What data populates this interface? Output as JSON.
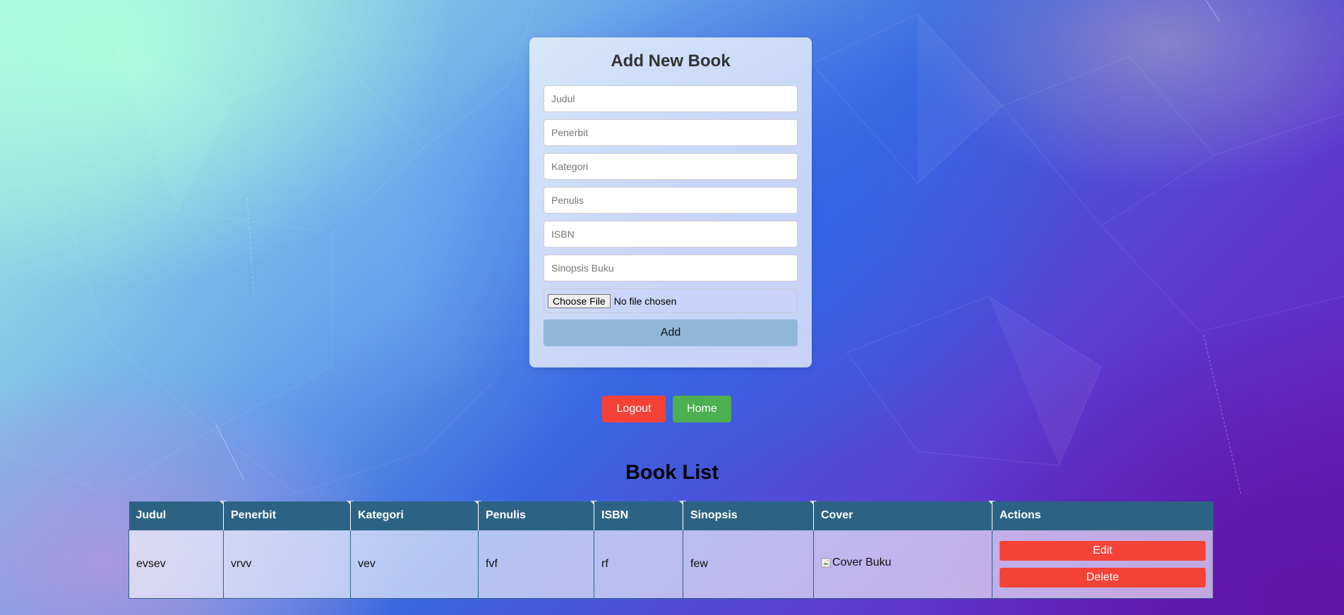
{
  "form": {
    "title": "Add New Book",
    "fields": [
      {
        "placeholder": "Judul",
        "value": ""
      },
      {
        "placeholder": "Penerbit",
        "value": ""
      },
      {
        "placeholder": "Kategori",
        "value": ""
      },
      {
        "placeholder": "Penulis",
        "value": ""
      },
      {
        "placeholder": "ISBN",
        "value": ""
      },
      {
        "placeholder": "Sinopsis Buku",
        "value": ""
      }
    ],
    "file_button": "Choose File",
    "file_status": "No file chosen",
    "submit_label": "Add"
  },
  "nav": {
    "logout_label": "Logout",
    "home_label": "Home"
  },
  "book_list": {
    "title": "Book List",
    "headers": [
      "Judul",
      "Penerbit",
      "Kategori",
      "Penulis",
      "ISBN",
      "Sinopsis",
      "Cover",
      "Actions"
    ],
    "rows": [
      {
        "judul": "evsev",
        "penerbit": "vrvv",
        "kategori": "vev",
        "penulis": "fvf",
        "isbn": "rf",
        "sinopsis": "few",
        "cover_alt": "Cover Buku",
        "edit_label": "Edit",
        "delete_label": "Delete"
      }
    ]
  },
  "colors": {
    "header_bg": "#2c6384",
    "danger": "#f44336",
    "success": "#4caf50",
    "submit_bg": "#8fb7d8"
  },
  "icons": [
    "broken-image-icon"
  ]
}
